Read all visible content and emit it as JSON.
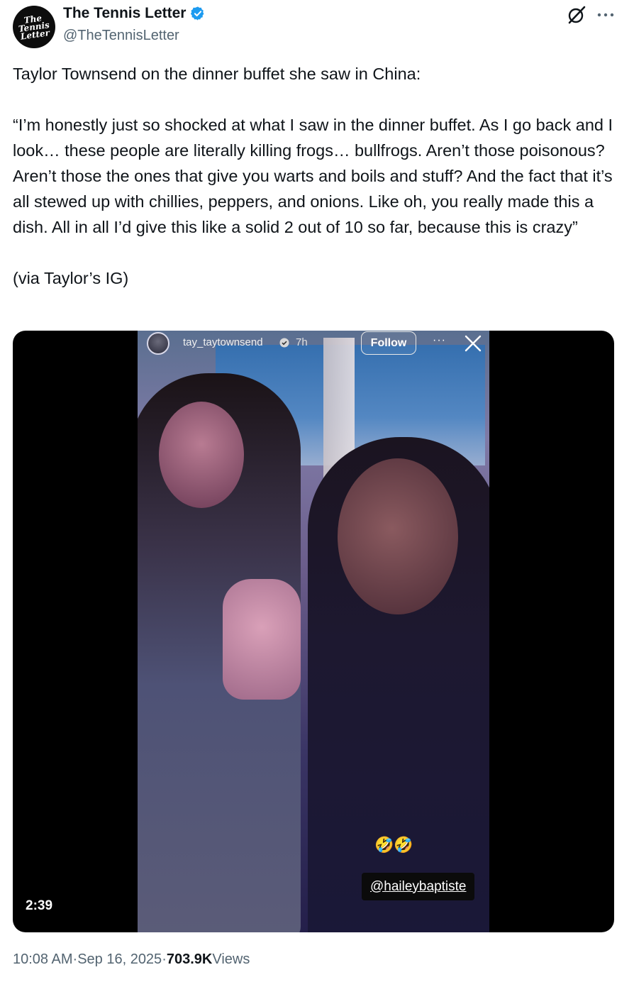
{
  "author": {
    "display_name": "The Tennis Letter",
    "handle": "@TheTennisLetter",
    "avatar_lines": [
      "The",
      "Tennis",
      "Letter"
    ],
    "verified_color": "#1d9bf0"
  },
  "tweet": {
    "paragraphs": [
      "Taylor Townsend on the dinner buffet she saw in China:",
      "“I’m honestly just so shocked at what I saw in the dinner buffet. As I go back and I look… these people are literally killing frogs… bullfrogs. Aren’t those poisonous? Aren’t those the ones that give you warts and boils and stuff? And the fact that it’s all stewed up with chillies, peppers, and onions. Like oh, you really made this a dish. All in all I’d give this like a solid 2 out of 10 so far, because this is crazy”",
      "(via Taylor’s IG)"
    ]
  },
  "video": {
    "duration": "2:39",
    "story": {
      "username": "tay_taytownsend",
      "time": "7h",
      "follow_label": "Follow",
      "more": "···",
      "emoji": "🤣🤣",
      "mention": "@haileybaptiste"
    }
  },
  "meta": {
    "time": "10:08 AM",
    "separator1": " · ",
    "date": "Sep 16, 2025",
    "separator2": " · ",
    "views_count": "703.9K",
    "views_label": " Views"
  }
}
